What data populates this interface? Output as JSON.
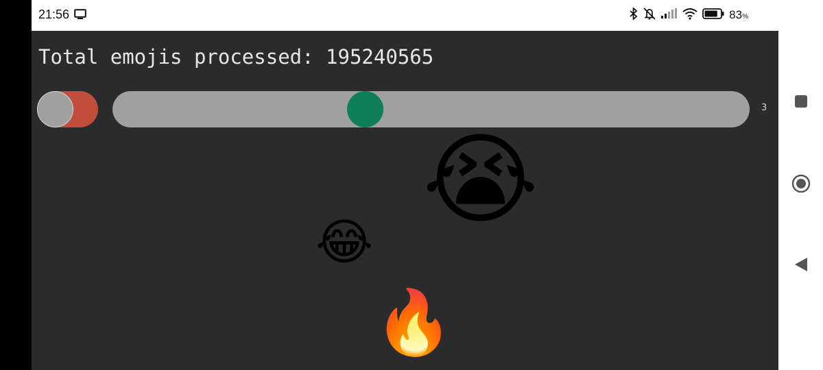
{
  "status_bar": {
    "time": "21:56",
    "battery_percent": "83",
    "battery_unit": "%",
    "battery_level": 0.83,
    "icons": [
      "screen-icon",
      "bluetooth-icon",
      "silent-icon",
      "signal-icon",
      "wifi-icon",
      "battery-icon"
    ]
  },
  "app": {
    "title": "Total emojis processed: 195240565",
    "toggle": {
      "on": false,
      "track_color": "#c24d3d",
      "knob_color": "#a0a0a0"
    },
    "slider": {
      "value": "3",
      "position": 0.39,
      "thumb_color": "#0e7f58",
      "track_color": "#a0a0a0"
    },
    "emojis": [
      "😭",
      "😂",
      "🔥"
    ],
    "background_color": "#2b2b2b"
  },
  "navigation": {
    "icons": [
      "recents-icon",
      "home-icon",
      "back-icon"
    ]
  }
}
